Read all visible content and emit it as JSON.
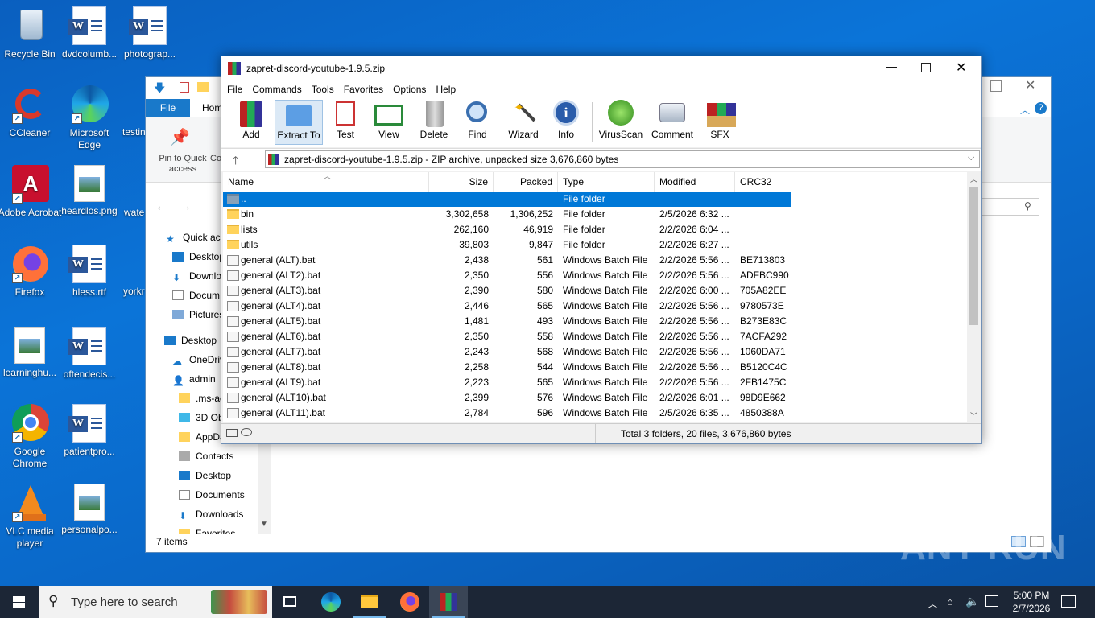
{
  "desktop": {
    "icons": [
      {
        "label": "Recycle Bin",
        "icon": "recycle-bin-icon"
      },
      {
        "label": "dvdcolumb...",
        "icon": "word-doc-icon"
      },
      {
        "label": "photograp...",
        "icon": "word-doc-icon"
      },
      {
        "label": "CCleaner",
        "icon": "ccleaner-icon"
      },
      {
        "label": "Microsoft Edge",
        "icon": "edge-icon"
      },
      {
        "label": "testin",
        "icon": "word-doc-icon"
      },
      {
        "label": "Adobe Acrobat",
        "icon": "acrobat-icon"
      },
      {
        "label": "heardlos.png",
        "icon": "image-file-icon"
      },
      {
        "label": "wate",
        "icon": "image-file-icon"
      },
      {
        "label": "Firefox",
        "icon": "firefox-icon"
      },
      {
        "label": "hless.rtf",
        "icon": "word-doc-icon"
      },
      {
        "label": "yorkr",
        "icon": "word-doc-icon"
      },
      {
        "label": "learninghu...",
        "icon": "image-file-icon"
      },
      {
        "label": "oftendecis...",
        "icon": "word-doc-icon"
      },
      {
        "label": "Google Chrome",
        "icon": "chrome-icon"
      },
      {
        "label": "patientpro...",
        "icon": "word-doc-icon"
      },
      {
        "label": "VLC media player",
        "icon": "vlc-icon"
      },
      {
        "label": "personalpo...",
        "icon": "image-file-icon"
      }
    ]
  },
  "explorer": {
    "file_tab": "File",
    "home_tab": "Hom",
    "pin_label": "Pin to Quick access",
    "co_label": "Co",
    "nav": [
      "Quick acc",
      "Desktop",
      "Downlo",
      "Docum",
      "Pictures",
      "Desktop",
      "OneDriv",
      "admin",
      ".ms-ad",
      "3D Obj",
      "AppDa",
      "Contacts",
      "Desktop",
      "Documents",
      "Downloads",
      "Favorites"
    ],
    "items_count": "7 items"
  },
  "rar": {
    "title": "zapret-discord-youtube-1.9.5.zip",
    "menu": [
      "File",
      "Commands",
      "Tools",
      "Favorites",
      "Options",
      "Help"
    ],
    "toolbar": [
      "Add",
      "Extract To",
      "Test",
      "View",
      "Delete",
      "Find",
      "Wizard",
      "Info",
      "VirusScan",
      "Comment",
      "SFX"
    ],
    "address": "zapret-discord-youtube-1.9.5.zip - ZIP archive, unpacked size 3,676,860 bytes",
    "columns": [
      "Name",
      "Size",
      "Packed",
      "Type",
      "Modified",
      "CRC32"
    ],
    "rows": [
      {
        "name": "..",
        "size": "",
        "packed": "",
        "type": "File folder",
        "modified": "",
        "crc": "",
        "kind": "up"
      },
      {
        "name": "bin",
        "size": "3,302,658",
        "packed": "1,306,252",
        "type": "File folder",
        "modified": "2/5/2026 6:32 ...",
        "crc": "",
        "kind": "folder"
      },
      {
        "name": "lists",
        "size": "262,160",
        "packed": "46,919",
        "type": "File folder",
        "modified": "2/2/2026 6:04 ...",
        "crc": "",
        "kind": "folder"
      },
      {
        "name": "utils",
        "size": "39,803",
        "packed": "9,847",
        "type": "File folder",
        "modified": "2/2/2026 6:27 ...",
        "crc": "",
        "kind": "folder"
      },
      {
        "name": "general (ALT).bat",
        "size": "2,438",
        "packed": "561",
        "type": "Windows Batch File",
        "modified": "2/2/2026 5:56 ...",
        "crc": "BE713803",
        "kind": "bat"
      },
      {
        "name": "general (ALT2).bat",
        "size": "2,350",
        "packed": "556",
        "type": "Windows Batch File",
        "modified": "2/2/2026 5:56 ...",
        "crc": "ADFBC990",
        "kind": "bat"
      },
      {
        "name": "general (ALT3).bat",
        "size": "2,390",
        "packed": "580",
        "type": "Windows Batch File",
        "modified": "2/2/2026 6:00 ...",
        "crc": "705A82EE",
        "kind": "bat"
      },
      {
        "name": "general (ALT4).bat",
        "size": "2,446",
        "packed": "565",
        "type": "Windows Batch File",
        "modified": "2/2/2026 5:56 ...",
        "crc": "9780573E",
        "kind": "bat"
      },
      {
        "name": "general (ALT5).bat",
        "size": "1,481",
        "packed": "493",
        "type": "Windows Batch File",
        "modified": "2/2/2026 5:56 ...",
        "crc": "B273E83C",
        "kind": "bat"
      },
      {
        "name": "general (ALT6).bat",
        "size": "2,350",
        "packed": "558",
        "type": "Windows Batch File",
        "modified": "2/2/2026 5:56 ...",
        "crc": "7ACFA292",
        "kind": "bat"
      },
      {
        "name": "general (ALT7).bat",
        "size": "2,243",
        "packed": "568",
        "type": "Windows Batch File",
        "modified": "2/2/2026 5:56 ...",
        "crc": "1060DA71",
        "kind": "bat"
      },
      {
        "name": "general (ALT8).bat",
        "size": "2,258",
        "packed": "544",
        "type": "Windows Batch File",
        "modified": "2/2/2026 5:56 ...",
        "crc": "B5120C4C",
        "kind": "bat"
      },
      {
        "name": "general (ALT9).bat",
        "size": "2,223",
        "packed": "565",
        "type": "Windows Batch File",
        "modified": "2/2/2026 5:56 ...",
        "crc": "2FB1475C",
        "kind": "bat"
      },
      {
        "name": "general (ALT10).bat",
        "size": "2,399",
        "packed": "576",
        "type": "Windows Batch File",
        "modified": "2/2/2026 6:01 ...",
        "crc": "98D9E662",
        "kind": "bat"
      },
      {
        "name": "general (ALT11).bat",
        "size": "2,784",
        "packed": "596",
        "type": "Windows Batch File",
        "modified": "2/5/2026 6:35 ...",
        "crc": "4850388A",
        "kind": "bat"
      }
    ],
    "status": "Total 3 folders, 20 files, 3,676,860 bytes"
  },
  "taskbar": {
    "search_placeholder": "Type here to search",
    "time": "5:00 PM",
    "date": "2/7/2026"
  },
  "watermark": "ANY RUN",
  "colors": {
    "selection": "#0078d7",
    "taskbar": "#1c2636",
    "explorer_file_tab": "#1979ca"
  }
}
